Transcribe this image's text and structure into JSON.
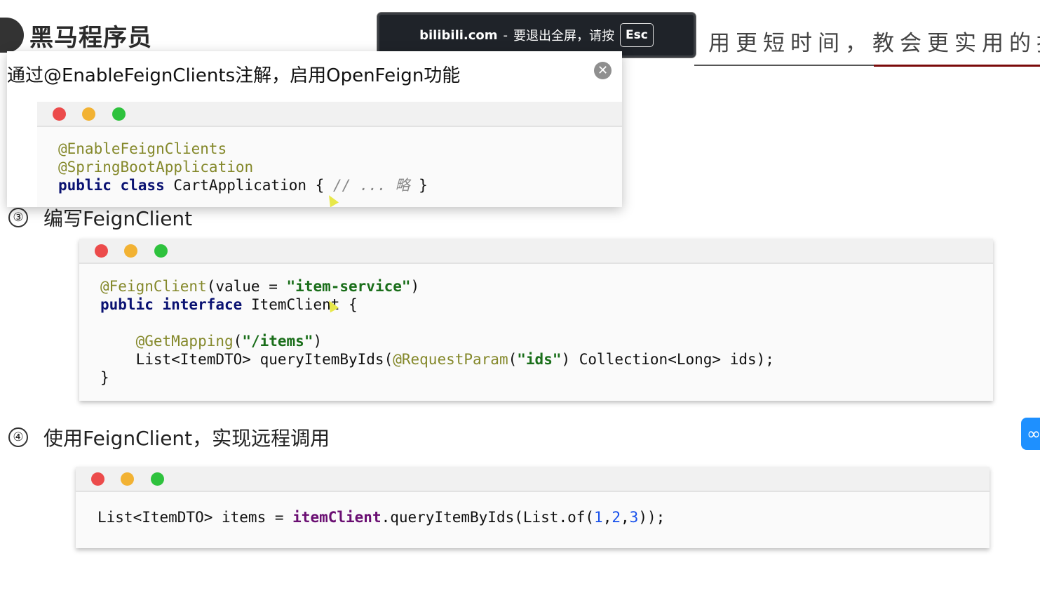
{
  "logo": {
    "text": "黑马程序员"
  },
  "slogan": "用更短时间，教会更实用的技",
  "toast": {
    "site": "bilibili.com",
    "separator": "-",
    "message": "要退出全屏，请按",
    "key": "Esc"
  },
  "popup": {
    "title": "通过@EnableFeignClients注解，启用OpenFeign功能",
    "close_icon": "close-icon",
    "code": [
      [
        {
          "t": "@EnableFeignClients",
          "c": "ann"
        }
      ],
      [
        {
          "t": "@SpringBootApplication",
          "c": "ann"
        }
      ],
      [
        {
          "t": "public class",
          "c": "kw"
        },
        {
          "t": " CartApplication { ",
          "c": ""
        },
        {
          "t": "// ... 略",
          "c": "cmt"
        },
        {
          "t": " }",
          "c": ""
        }
      ]
    ]
  },
  "section3": {
    "number": "③",
    "title": "编写FeignClient"
  },
  "code3": [
    [
      {
        "t": "@FeignClient",
        "c": "ann"
      },
      {
        "t": "(value = ",
        "c": ""
      },
      {
        "t": "\"item-service\"",
        "c": "str"
      },
      {
        "t": ")",
        "c": ""
      }
    ],
    [
      {
        "t": "public interface",
        "c": "kw"
      },
      {
        "t": " ItemClient {",
        "c": ""
      }
    ],
    [],
    [
      {
        "t": "    ",
        "c": ""
      },
      {
        "t": "@GetMapping",
        "c": "ann"
      },
      {
        "t": "(",
        "c": ""
      },
      {
        "t": "\"/items\"",
        "c": "str"
      },
      {
        "t": ")",
        "c": ""
      }
    ],
    [
      {
        "t": "    List<ItemDTO> queryItemByIds(",
        "c": ""
      },
      {
        "t": "@RequestParam",
        "c": "ann"
      },
      {
        "t": "(",
        "c": ""
      },
      {
        "t": "\"ids\"",
        "c": "str"
      },
      {
        "t": ") Collection<Long> ids);",
        "c": ""
      }
    ],
    [
      {
        "t": "}",
        "c": ""
      }
    ]
  ],
  "section4": {
    "number": "④",
    "title": "使用FeignClient，实现远程调用"
  },
  "code4": [
    [
      {
        "t": "List<ItemDTO> items = ",
        "c": ""
      },
      {
        "t": "itemClient",
        "c": "fld"
      },
      {
        "t": ".queryItemByIds(List.of(",
        "c": ""
      },
      {
        "t": "1",
        "c": "num"
      },
      {
        "t": ",",
        "c": ""
      },
      {
        "t": "2",
        "c": "num"
      },
      {
        "t": ",",
        "c": ""
      },
      {
        "t": "3",
        "c": "num"
      },
      {
        "t": "));",
        "c": ""
      }
    ]
  ],
  "side_button": {
    "icon": "link-icon",
    "color": "#1e90ff"
  }
}
